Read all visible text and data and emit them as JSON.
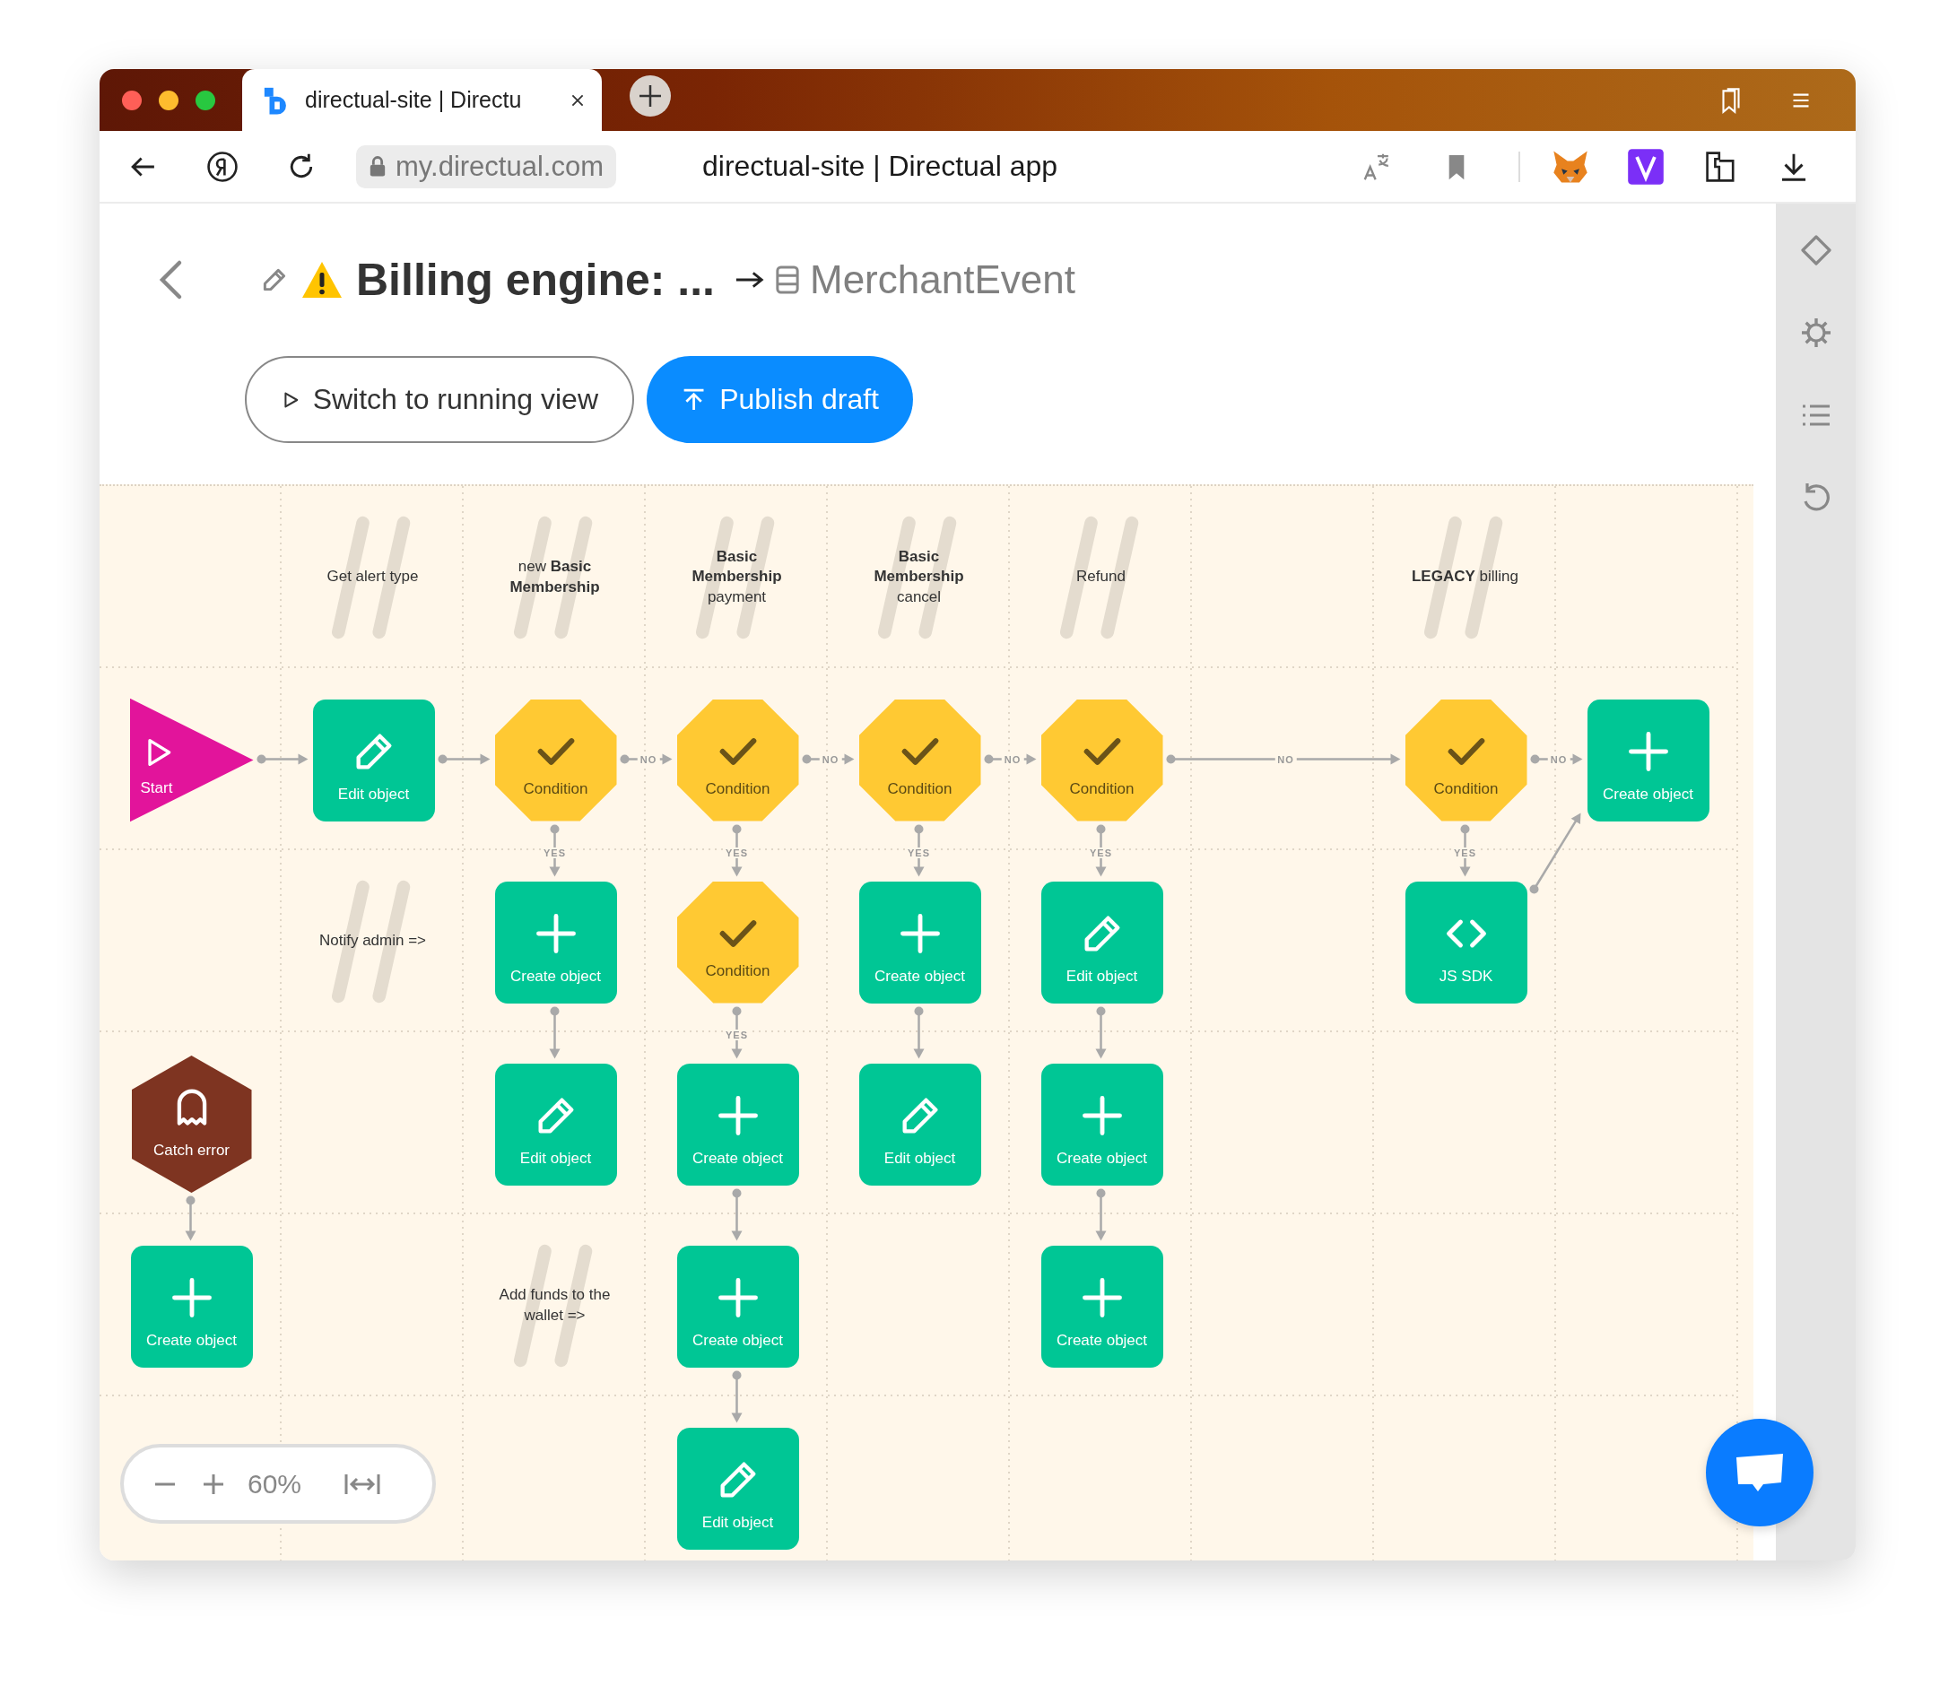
{
  "browser": {
    "tabs": [
      {
        "title": "directual-site | Directu",
        "selected": true
      }
    ],
    "address": "my.directual.com",
    "page_title": "directual-site | Directual app"
  },
  "header": {
    "title": "Billing engine: ...",
    "target": "MerchantEvent"
  },
  "buttons": [
    {
      "label": "Switch to running view",
      "kind": "outline"
    },
    {
      "label": "Publish draft",
      "kind": "primary"
    }
  ],
  "canvas": {
    "rows": [
      {
        "cells": [
          {
            "kind": "empty"
          },
          {
            "kind": "comment",
            "text": "Get alert type"
          },
          {
            "kind": "comment",
            "text": "new **Basic Membership**"
          },
          {
            "kind": "comment",
            "text": "**Basic Membership** payment"
          },
          {
            "kind": "comment",
            "text": "**Basic Membership** cancel"
          },
          {
            "kind": "comment",
            "text": "Refund"
          },
          {
            "kind": "empty"
          },
          {
            "kind": "comment",
            "text": "**LEGACY** billing"
          },
          {
            "kind": "empty"
          }
        ]
      },
      {
        "cells": [
          {
            "kind": "start",
            "label": "Start",
            "next": [
              {
                "kind": "right"
              }
            ]
          },
          {
            "kind": "edit",
            "label": "Edit object",
            "next": [
              {
                "kind": "right"
              }
            ]
          },
          {
            "kind": "condition",
            "label": "Condition",
            "next": [
              {
                "kind": "right",
                "label": "NO"
              },
              {
                "kind": "down",
                "label": "YES"
              }
            ]
          },
          {
            "kind": "condition",
            "label": "Condition",
            "next": [
              {
                "kind": "right",
                "label": "NO"
              },
              {
                "kind": "down",
                "label": "YES"
              }
            ]
          },
          {
            "kind": "condition",
            "label": "Condition",
            "next": [
              {
                "kind": "right",
                "label": "NO"
              },
              {
                "kind": "down",
                "label": "YES"
              }
            ]
          },
          {
            "kind": "condition",
            "label": "Condition",
            "next": [
              {
                "kind": "right",
                "label": "NO"
              },
              {
                "kind": "down",
                "label": "YES"
              }
            ]
          },
          {
            "kind": "empty"
          },
          {
            "kind": "condition",
            "label": "Condition",
            "next": [
              {
                "kind": "right",
                "label": "NO"
              },
              {
                "kind": "down",
                "label": "YES"
              }
            ]
          },
          {
            "kind": "create",
            "label": "Create object"
          }
        ]
      },
      {
        "cells": [
          {
            "kind": "empty"
          },
          {
            "kind": "comment",
            "text": "Notify admin =>"
          },
          {
            "kind": "create",
            "label": "Create object",
            "next": [
              {
                "kind": "down"
              }
            ]
          },
          {
            "kind": "condition",
            "label": "Condition",
            "next": [
              {
                "kind": "down",
                "label": "YES"
              }
            ]
          },
          {
            "kind": "create",
            "label": "Create object",
            "next": [
              {
                "kind": "down"
              }
            ]
          },
          {
            "kind": "edit",
            "label": "Edit object",
            "next": [
              {
                "kind": "down"
              }
            ]
          },
          {
            "kind": "empty"
          },
          {
            "kind": "code",
            "label": "JS SDK",
            "next": [
              {
                "kind": "up-right"
              }
            ]
          },
          {
            "kind": "empty"
          }
        ]
      },
      {
        "cells": [
          {
            "kind": "catch",
            "label": "Catch error",
            "next": [
              {
                "kind": "down"
              }
            ]
          },
          {
            "kind": "empty"
          },
          {
            "kind": "edit",
            "label": "Edit object"
          },
          {
            "kind": "create",
            "label": "Create object",
            "next": [
              {
                "kind": "down"
              }
            ]
          },
          {
            "kind": "edit",
            "label": "Edit object"
          },
          {
            "kind": "create",
            "label": "Create object",
            "next": [
              {
                "kind": "down"
              }
            ]
          },
          {
            "kind": "empty"
          },
          {
            "kind": "empty"
          },
          {
            "kind": "empty"
          }
        ]
      },
      {
        "cells": [
          {
            "kind": "create",
            "label": "Create object"
          },
          {
            "kind": "empty"
          },
          {
            "kind": "comment",
            "text": "Add funds to the wallet =>"
          },
          {
            "kind": "create",
            "label": "Create object",
            "next": [
              {
                "kind": "down"
              }
            ]
          },
          {
            "kind": "empty"
          },
          {
            "kind": "create",
            "label": "Create object"
          },
          {
            "kind": "empty"
          },
          {
            "kind": "empty"
          },
          {
            "kind": "empty"
          }
        ]
      },
      {
        "cells": [
          {
            "kind": "empty"
          },
          {
            "kind": "empty"
          },
          {
            "kind": "empty"
          },
          {
            "kind": "edit",
            "label": "Edit object"
          },
          {
            "kind": "empty"
          },
          {
            "kind": "empty"
          },
          {
            "kind": "empty"
          },
          {
            "kind": "empty"
          },
          {
            "kind": "empty"
          }
        ]
      }
    ]
  },
  "zoom": {
    "value": "60%"
  }
}
